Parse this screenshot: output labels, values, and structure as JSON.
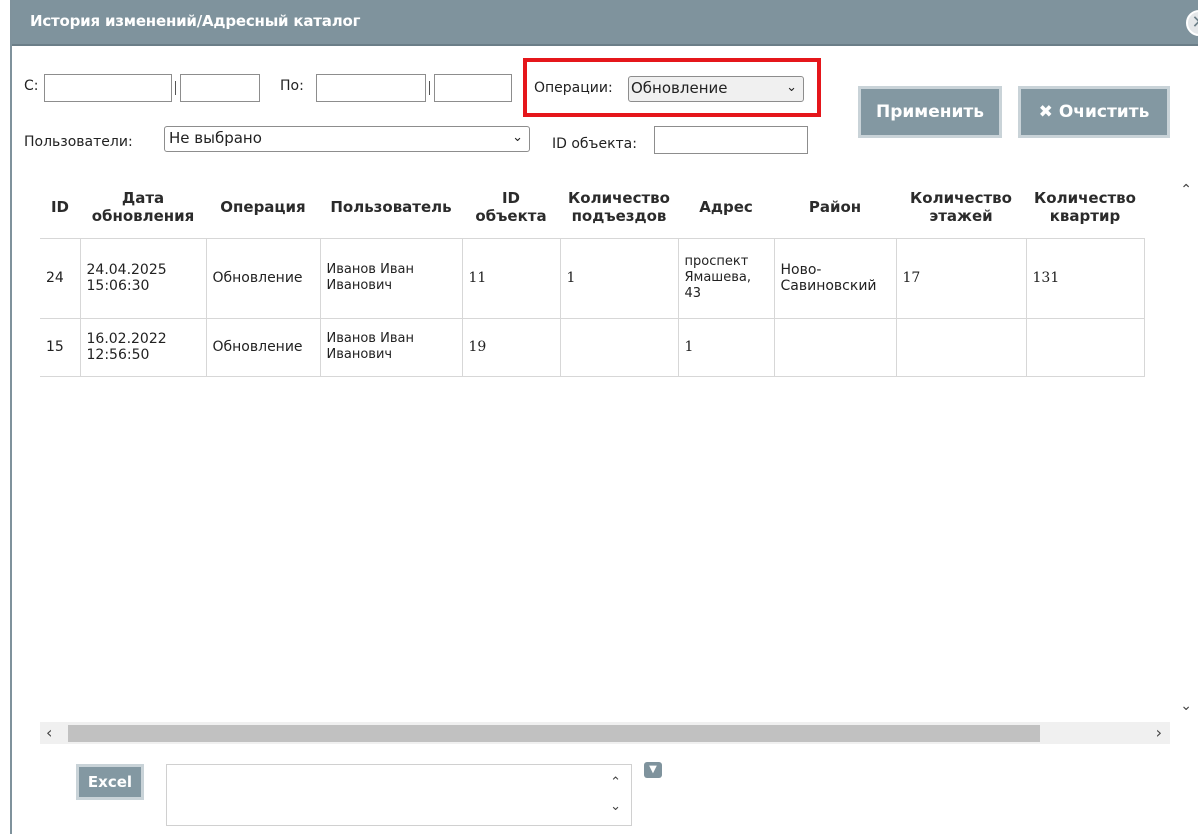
{
  "window": {
    "title": "История изменений/Адресный каталог",
    "close_glyph": "✕"
  },
  "filters": {
    "from_label": "С:",
    "from_date": "",
    "from_time": "",
    "to_label": "По:",
    "to_date": "",
    "to_time": "",
    "operations_label": "Операции:",
    "operations_value": "Обновление",
    "users_label": "Пользователи:",
    "users_value": "Не выбрано",
    "object_id_label": "ID объекта:",
    "object_id_value": ""
  },
  "buttons": {
    "apply": "Применить",
    "clear": "✖ Очистить",
    "excel": "Excel"
  },
  "table": {
    "headers": [
      "ID",
      "Дата обновления",
      "Операция",
      "Пользователь",
      "ID объекта",
      "Количество подъездов",
      "Адрес",
      "Район",
      "Количество этажей",
      "Количество квартир"
    ],
    "rows": [
      {
        "id": "24",
        "date": "24.04.2025 15:06:30",
        "operation": "Обновление",
        "user": "Иванов Иван Иванович",
        "object_id": "11",
        "entrances": "1",
        "address": "проспект Ямашева, 43",
        "district": "Ново-Савиновский",
        "floors": "17",
        "apartments": "131"
      },
      {
        "id": "15",
        "date": "16.02.2022 12:56:50",
        "operation": "Обновление",
        "user": "Иванов Иван Иванович",
        "object_id": "19",
        "entrances": "",
        "address": "1",
        "district": "",
        "floors": "",
        "apartments": ""
      }
    ]
  },
  "colors": {
    "titlebar": "#7f939d",
    "button": "#8398a2",
    "highlight": "#e5161b"
  },
  "icons": [
    "close-icon",
    "chevron-down-icon",
    "scroll-up-icon",
    "scroll-down-icon",
    "scroll-left-icon",
    "scroll-right-icon",
    "dropdown-icon"
  ]
}
